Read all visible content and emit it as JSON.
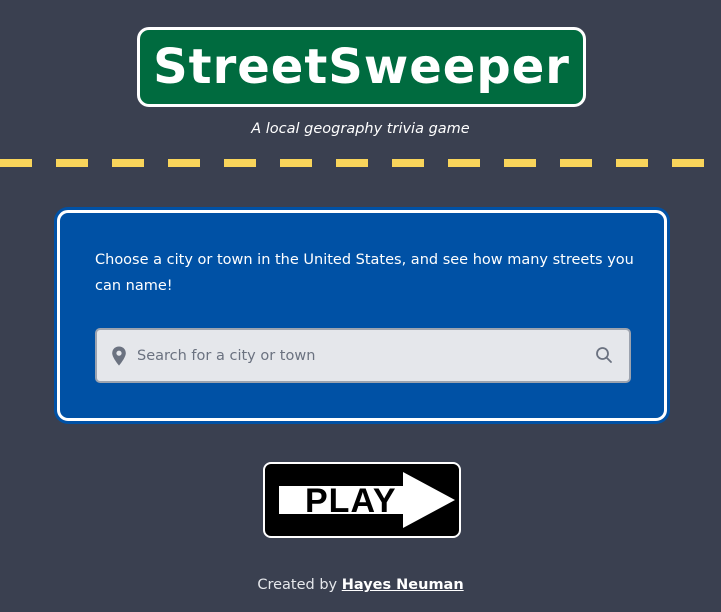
{
  "header": {
    "logo_text": "StreetSweeper",
    "tagline": "A local geography trivia game"
  },
  "card": {
    "description": "Choose a city or town in the United States, and see how many streets you can name!",
    "search": {
      "placeholder": "Search for a city or town",
      "value": ""
    }
  },
  "play_button": {
    "label": "PLAY"
  },
  "footer": {
    "prefix": "Created by ",
    "author": "Hayes Neuman"
  },
  "colors": {
    "background": "#3a4050",
    "sign_green": "#006b3f",
    "card_blue": "#0051a5",
    "road_yellow": "#f9d55b"
  },
  "icons": {
    "search_prefix": "map-pin-icon",
    "search_suffix": "search-icon",
    "play": "arrow-right-icon"
  }
}
